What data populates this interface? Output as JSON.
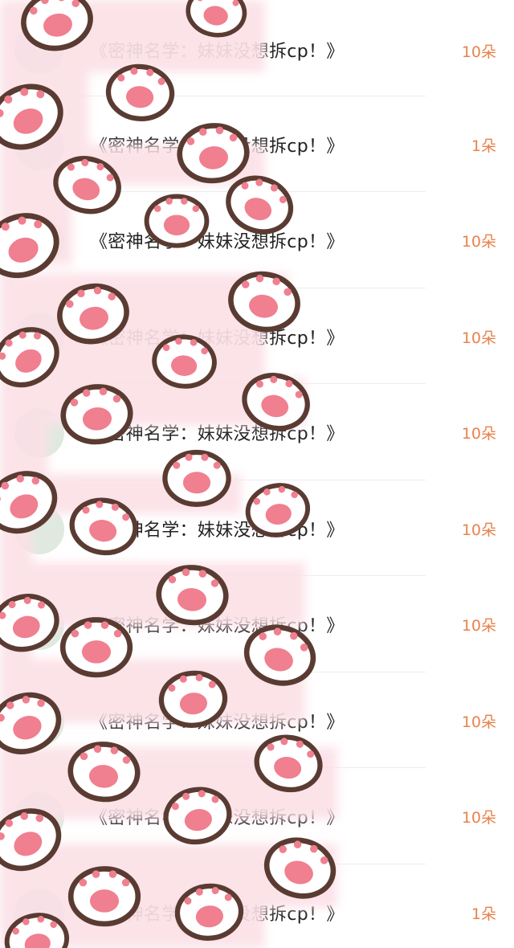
{
  "gift_list": {
    "rows": [
      {
        "title": "《密神名学：妹妹没想拆cp！》",
        "amount": "10朵"
      },
      {
        "title": "《密神名学：妹妹没想拆cp！》",
        "amount": "1朵"
      },
      {
        "title": "《密神名学：妹妹没想拆cp！》",
        "amount": "10朵"
      },
      {
        "title": "《密神名学：妹妹没想拆cp！》",
        "amount": "10朵"
      },
      {
        "title": "《密神名学：妹妹没想拆cp！》",
        "amount": "10朵"
      },
      {
        "title": "《密神名学：妹妹没想拆cp！》",
        "amount": "10朵"
      },
      {
        "title": "《密神名学：妹妹没想拆cp！》",
        "amount": "10朵"
      },
      {
        "title": "《密神名学：妹妹没想拆cp！》",
        "amount": "10朵"
      },
      {
        "title": "《密神名学：妹妹没想拆cp！》",
        "amount": "10朵"
      },
      {
        "title": "《密神名学：妹妹没想拆cp！》",
        "amount": "1朵"
      }
    ]
  },
  "colors": {
    "amount": "#e8834a",
    "title": "#222222",
    "sticker_pink": "#fbe1e7",
    "paw_outline": "#5a3b32",
    "paw_pad": "#f07f8f"
  },
  "icons": {
    "overlay": "paw-print-sticker-icon"
  }
}
